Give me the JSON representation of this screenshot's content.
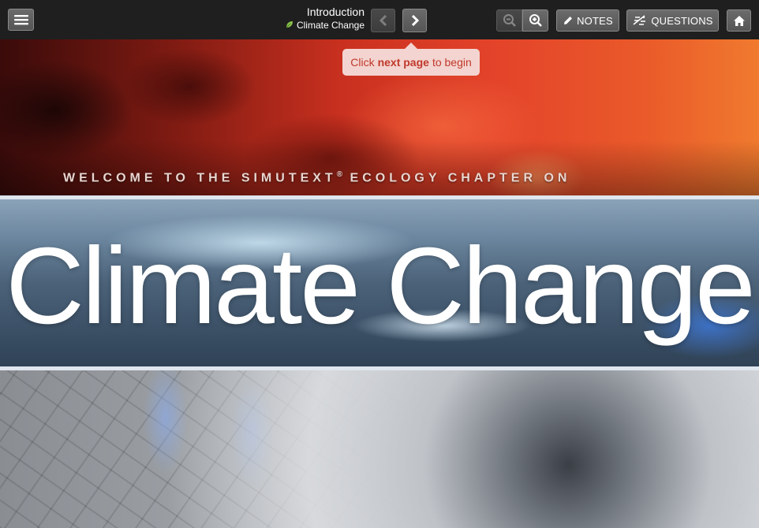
{
  "header": {
    "menu_icon": "hamburger-menu-icon",
    "section_title": "Introduction",
    "chapter_title": "Climate Change",
    "chapter_icon": "leaf-icon",
    "prev_icon": "chevron-left-icon",
    "next_icon": "chevron-right-icon",
    "zoom_out_icon": "zoom-out-icon",
    "zoom_in_icon": "zoom-in-icon",
    "notes_label": "NOTES",
    "notes_icon": "pencil-icon",
    "questions_label": "QUESTIONS",
    "questions_icon": "questions-icon",
    "home_icon": "home-icon"
  },
  "tooltip": {
    "prefix": "Click",
    "bold": "next page",
    "suffix": "to begin"
  },
  "hero": {
    "welcome_line": "WELCOME TO THE SIMUTEXT",
    "registered_mark": "®",
    "welcome_suffix": " ECOLOGY CHAPTER ON",
    "title": "Climate Change"
  },
  "colors": {
    "tooltip_text": "#c0392b",
    "tooltip_bg": "#f3d4d0",
    "leaf": "#8bc34a"
  }
}
